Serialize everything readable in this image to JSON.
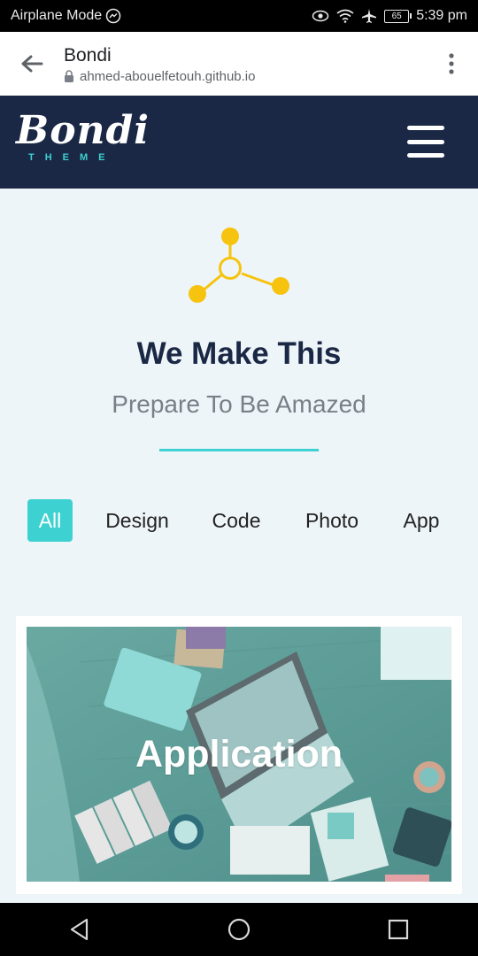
{
  "status": {
    "mode_text": "Airplane Mode",
    "battery": "65",
    "time": "5:39 pm"
  },
  "browser": {
    "title": "Bondi",
    "url": "ahmed-abouelfetouh.github.io"
  },
  "header": {
    "logo_main": "Bondi",
    "logo_sub": "THEME"
  },
  "hero": {
    "title": "We Make This",
    "subtitle": "Prepare To Be Amazed"
  },
  "filters": [
    {
      "label": "All",
      "active": true
    },
    {
      "label": "Design",
      "active": false
    },
    {
      "label": "Code",
      "active": false
    },
    {
      "label": "Photo",
      "active": false
    },
    {
      "label": "App",
      "active": false
    }
  ],
  "card": {
    "title": "Application"
  },
  "colors": {
    "accent": "#3dd1d1",
    "header_bg": "#1b2845",
    "icon_yellow": "#f6c30f",
    "page_bg": "#eef5f9"
  }
}
